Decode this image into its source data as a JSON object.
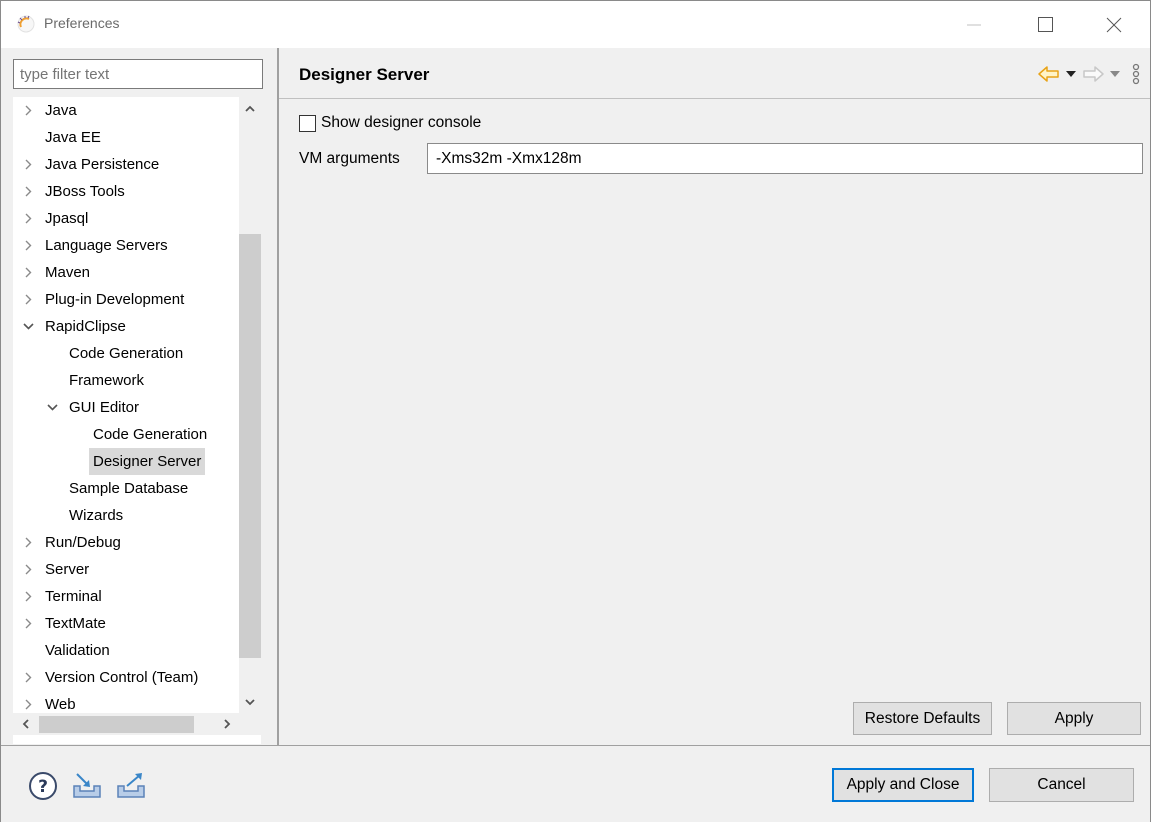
{
  "window": {
    "title": "Preferences",
    "icon": "eclipse-sun-icon",
    "controls": {
      "minimize": "minimize-icon",
      "maximize": "maximize-icon",
      "close": "close-icon"
    }
  },
  "filter": {
    "placeholder": "type filter text",
    "value": ""
  },
  "tree": {
    "items": [
      {
        "label": "Java",
        "level": 0,
        "expander": "collapsed"
      },
      {
        "label": "Java EE",
        "level": 0,
        "expander": "none"
      },
      {
        "label": "Java Persistence",
        "level": 0,
        "expander": "collapsed"
      },
      {
        "label": "JBoss Tools",
        "level": 0,
        "expander": "collapsed"
      },
      {
        "label": "Jpasql",
        "level": 0,
        "expander": "collapsed"
      },
      {
        "label": "Language Servers",
        "level": 0,
        "expander": "collapsed"
      },
      {
        "label": "Maven",
        "level": 0,
        "expander": "collapsed"
      },
      {
        "label": "Plug-in Development",
        "level": 0,
        "expander": "collapsed"
      },
      {
        "label": "RapidClipse",
        "level": 0,
        "expander": "expanded"
      },
      {
        "label": "Code Generation",
        "level": 1,
        "expander": "none"
      },
      {
        "label": "Framework",
        "level": 1,
        "expander": "none"
      },
      {
        "label": "GUI Editor",
        "level": 1,
        "expander": "expanded"
      },
      {
        "label": "Code Generation",
        "level": 2,
        "expander": "none"
      },
      {
        "label": "Designer Server",
        "level": 2,
        "expander": "none",
        "selected": true
      },
      {
        "label": "Sample Database",
        "level": 1,
        "expander": "none"
      },
      {
        "label": "Wizards",
        "level": 1,
        "expander": "none"
      },
      {
        "label": "Run/Debug",
        "level": 0,
        "expander": "collapsed"
      },
      {
        "label": "Server",
        "level": 0,
        "expander": "collapsed"
      },
      {
        "label": "Terminal",
        "level": 0,
        "expander": "collapsed"
      },
      {
        "label": "TextMate",
        "level": 0,
        "expander": "collapsed"
      },
      {
        "label": "Validation",
        "level": 0,
        "expander": "none"
      },
      {
        "label": "Version Control (Team)",
        "level": 0,
        "expander": "collapsed"
      },
      {
        "label": "Web",
        "level": 0,
        "expander": "collapsed"
      }
    ]
  },
  "page": {
    "title": "Designer Server",
    "nav": {
      "back": "back-arrow-icon",
      "back_menu": "back-dropdown-icon",
      "forward": "forward-arrow-icon",
      "forward_menu": "forward-dropdown-icon",
      "more": "more-vertical-icon"
    },
    "show_console": {
      "label": "Show designer console",
      "checked": false
    },
    "vm_arguments": {
      "label": "VM arguments",
      "value": "-Xms32m -Xmx128m"
    },
    "restore_defaults_label": "Restore Defaults",
    "apply_label": "Apply"
  },
  "footer": {
    "icons": [
      "help-icon",
      "import-icon",
      "export-icon"
    ],
    "apply_close_label": "Apply and Close",
    "cancel_label": "Cancel"
  },
  "colors": {
    "focus_border": "#0078d7",
    "selection_bg": "#d9d9d9",
    "back_arrow": "#e8a317"
  }
}
